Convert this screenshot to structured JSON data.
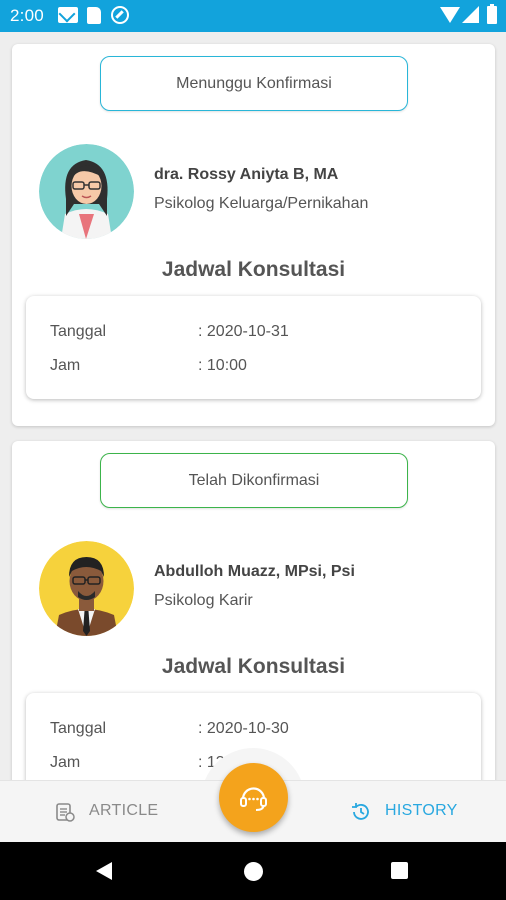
{
  "status_bar": {
    "time": "2:00"
  },
  "appointments": [
    {
      "status": "Menunggu Konfirmasi",
      "status_color": "#29b6d8",
      "doctor_name": "dra. Rossy Aniyta B, MA",
      "doctor_role": "Psikolog Keluarga/Pernikahan",
      "avatar_bg": "#7fd3cf",
      "schedule_title": "Jadwal Konsultasi",
      "date_label": "Tanggal",
      "date_value": ": 2020-10-31",
      "time_label": "Jam",
      "time_value": ": 10:00"
    },
    {
      "status": "Telah Dikonfirmasi",
      "status_color": "#3cb44b",
      "doctor_name": "Abdulloh Muazz, MPsi, Psi",
      "doctor_role": "Psikolog Karir",
      "avatar_bg": "#f6d23c",
      "schedule_title": "Jadwal Konsultasi",
      "date_label": "Tanggal",
      "date_value": ": 2020-10-30",
      "time_label": "Jam",
      "time_value": ": 13"
    }
  ],
  "bottom_nav": {
    "article_label": "ARTICLE",
    "article_icon": "article-icon",
    "history_label": "HISTORY",
    "history_icon": "history-icon",
    "fab_icon": "consultation-headset-icon",
    "active": "history",
    "accent_color": "#29a8e0",
    "fab_color": "#f4a31c"
  }
}
